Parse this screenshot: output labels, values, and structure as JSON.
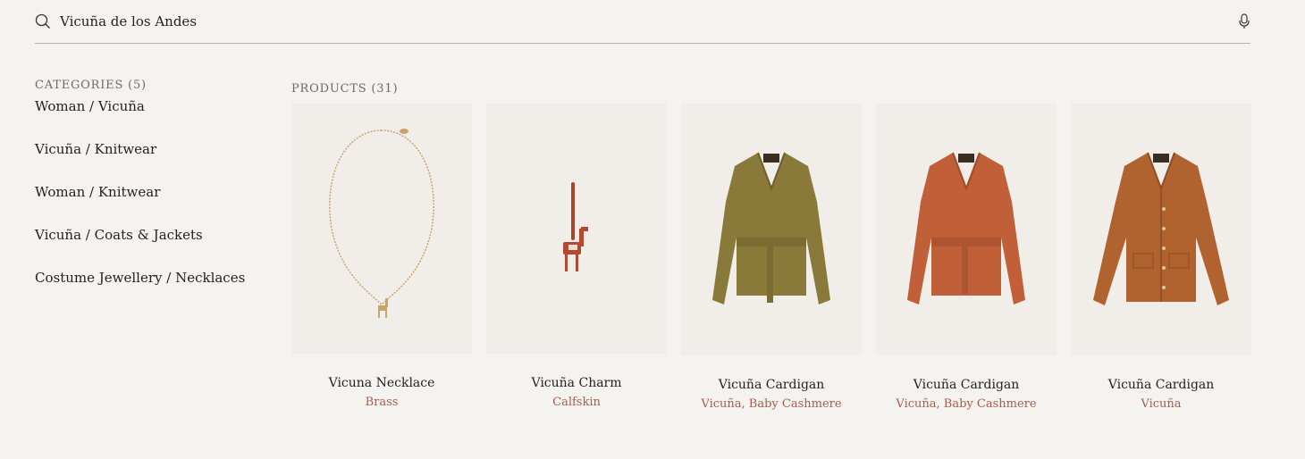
{
  "search": {
    "value": "Vicuña de los Andes",
    "icon": "search-icon",
    "mic_icon": "microphone-icon"
  },
  "categories": {
    "title": "CATEGORIES (5)",
    "items": [
      "Woman / Vicuña",
      "Vicuña / Knitwear",
      "Woman / Knitwear",
      "Vicuña / Coats & Jackets",
      "Costume Jewellery / Necklaces"
    ]
  },
  "products": {
    "title": "PRODUCTS (31)",
    "items": [
      {
        "name": "Vicuna Necklace",
        "material": "Brass"
      },
      {
        "name": "Vicuña Charm",
        "material": "Calfskin"
      },
      {
        "name": "Vicuña Cardigan",
        "material": "Vicuña, Baby Cashmere"
      },
      {
        "name": "Vicuña Cardigan",
        "material": "Vicuña, Baby Cashmere"
      },
      {
        "name": "Vicuña Cardigan",
        "material": "Vicuña"
      }
    ]
  },
  "colors": {
    "background": "#f5f3ef",
    "accent": "#a65c4c",
    "card": "#f1eeea"
  }
}
